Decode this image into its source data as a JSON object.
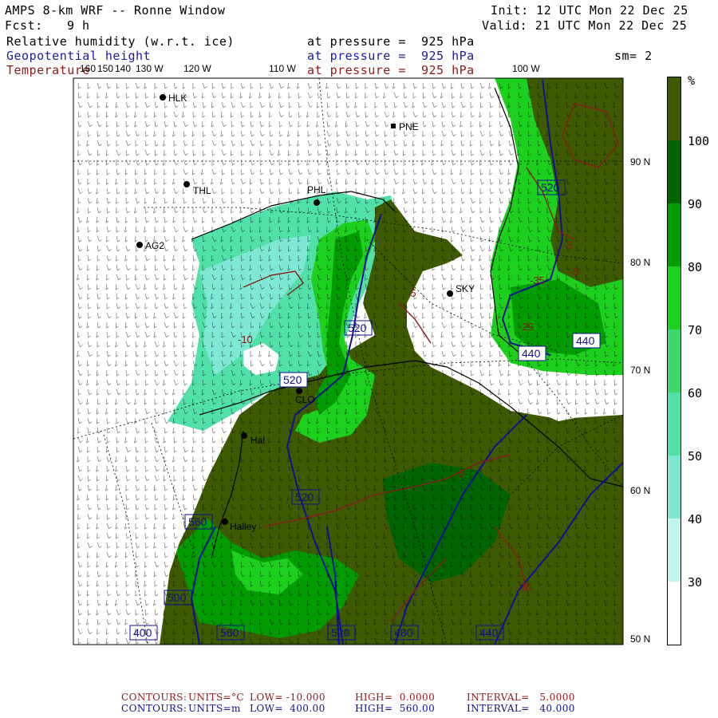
{
  "header": {
    "title": "AMPS 8-km WRF -- Ronne Window",
    "init": "Init: 12 UTC Mon 22 Dec 25",
    "fcst_label": "Fcst:",
    "fcst_value": "9 h",
    "valid": "Valid: 21 UTC Mon 22 Dec 25",
    "field_rh": "Relative humidity (w.r.t. ice)",
    "field_gh": "Geopotential height",
    "field_t": "Temperature",
    "pressure_rh": "at pressure =  925 hPa",
    "pressure_gh": "at pressure =  925 hPa",
    "pressure_t": "at pressure =  925 hPa",
    "smooth": "sm= 2"
  },
  "longitude_labels": [
    "160",
    "150",
    "140",
    "130 W",
    "120 W",
    "110 W",
    "100 W"
  ],
  "latitude_labels": [
    "90 N",
    "80 N",
    "70 N",
    "60 N",
    "50 N"
  ],
  "stations": [
    "HLK",
    "PNE",
    "THL",
    "PHL",
    "AG2",
    "SKY",
    "CLO",
    "Hal",
    "Halley"
  ],
  "contour_labels": {
    "height": [
      "520",
      "520",
      "520",
      "520",
      "520",
      "560",
      "560",
      "500",
      "480",
      "440",
      "440",
      "400",
      "440"
    ],
    "temperature": [
      "-10",
      "-5",
      "-5",
      "-5",
      "-5",
      "-10",
      "-35",
      "-29"
    ]
  },
  "colorbar": {
    "unit": "%",
    "levels": [
      "100",
      "90",
      "80",
      "70",
      "60",
      "50",
      "40",
      "30"
    ],
    "colors": [
      "#3d5a00",
      "#006400",
      "#009c00",
      "#1ed01e",
      "#3cd96e",
      "#50e0a8",
      "#7ee8d4",
      "#c2f5ea",
      "#ffffff"
    ]
  },
  "colors": {
    "land_dark": "#3d5a00",
    "rh_90": "#006400",
    "rh_80": "#009c00",
    "rh_70": "#1ed01e",
    "rh_60": "#3cd96e",
    "rh_50": "#50e0a8",
    "rh_40": "#7ee8d4",
    "height_contour": "#101090",
    "temp_contour": "#8b1a1a"
  },
  "footer": {
    "t_contours": "CONTOURS:",
    "t_units": "UNITS=°C",
    "t_low": "LOW= -10.000",
    "t_high": "HIGH=  0.0000",
    "t_interval": "INTERVAL=   5.0000",
    "h_contours": "CONTOURS:",
    "h_units": "UNITS=m",
    "h_low": "LOW=  400.00",
    "h_high": "HIGH=  560.00",
    "h_interval": "INTERVAL=   40.000"
  }
}
